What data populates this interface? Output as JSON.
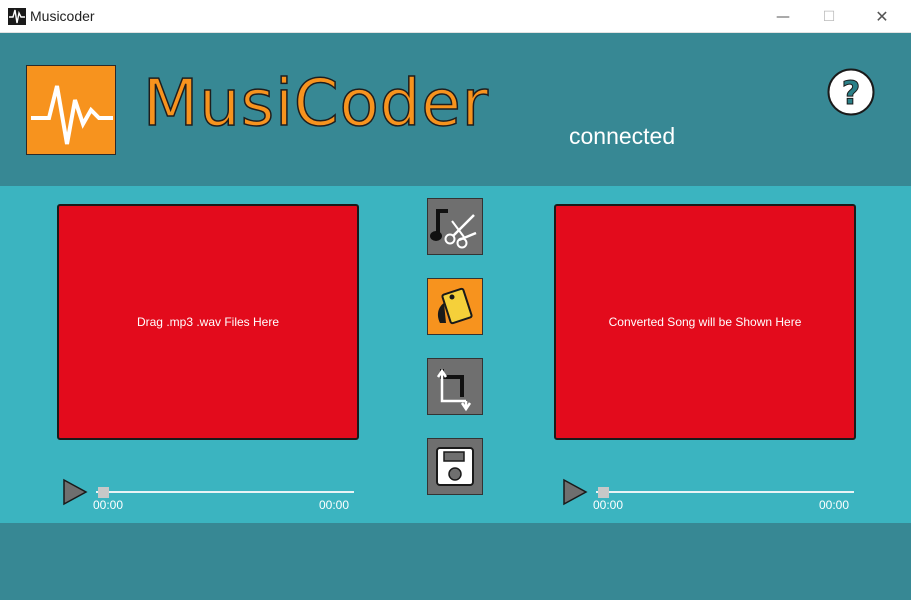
{
  "window": {
    "title": "Musicoder",
    "controls": {
      "minimize": "—",
      "maximize": "☐",
      "close": "✕"
    }
  },
  "header": {
    "brand": "MusiCoder",
    "status": "connected",
    "help_icon": "question-mark-icon"
  },
  "panels": {
    "input": {
      "text": "Drag .mp3 .wav Files Here"
    },
    "output": {
      "text": "Converted Song will be Shown Here"
    }
  },
  "tools": [
    {
      "name": "music-cut",
      "icon": "music-scissors-icon",
      "active": false
    },
    {
      "name": "color-swatch",
      "icon": "color-swatch-icon",
      "active": true
    },
    {
      "name": "crop",
      "icon": "crop-icon",
      "active": false
    },
    {
      "name": "save",
      "icon": "floppy-disk-icon",
      "active": false
    }
  ],
  "players": {
    "input": {
      "current": "00:00",
      "total": "00:00",
      "progress": 0
    },
    "output": {
      "current": "00:00",
      "total": "00:00",
      "progress": 0
    }
  },
  "colors": {
    "header_bg": "#378894",
    "main_bg": "#3bb4c0",
    "panel_red": "#e30b1c",
    "brand_orange": "#f7931e",
    "button_gray": "#6f6f6f"
  }
}
